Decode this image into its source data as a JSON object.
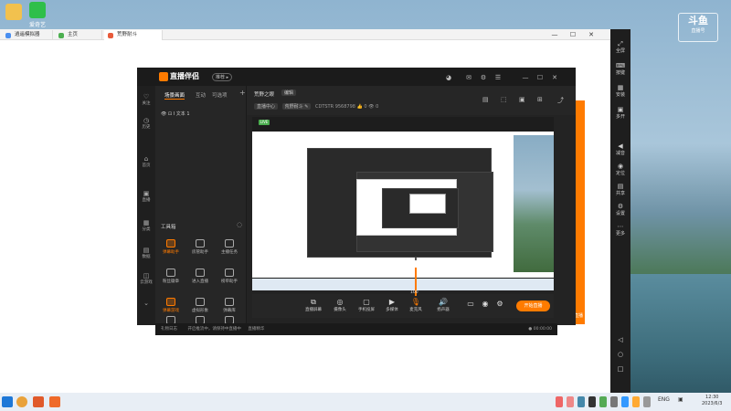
{
  "desktop": {
    "icons": [
      {
        "label": ""
      },
      {
        "label": "爱奇艺"
      }
    ]
  },
  "emulator": {
    "tabs": [
      {
        "label": "逍遥模拟器",
        "active": false
      },
      {
        "label": "主页",
        "active": false
      },
      {
        "label": "荒野耐斗",
        "active": true
      }
    ],
    "controls": {
      "minimize": "—",
      "maximize": "☐",
      "close": "✕"
    },
    "sidebar": [
      {
        "icon": "⤢",
        "label": "全屏"
      },
      {
        "icon": "⌨",
        "label": "按键"
      },
      {
        "icon": "▦",
        "label": "安装"
      },
      {
        "icon": "▣",
        "label": "多开"
      },
      {
        "icon": "◀",
        "label": "减音"
      },
      {
        "icon": "◉",
        "label": "定位"
      },
      {
        "icon": "▤",
        "label": "共享"
      },
      {
        "icon": "⚙",
        "label": "设置"
      },
      {
        "icon": "⋯",
        "label": "更多"
      },
      {
        "icon": "◁",
        "label": ""
      },
      {
        "icon": "○",
        "label": ""
      },
      {
        "icon": "□",
        "label": ""
      }
    ]
  },
  "watermark": {
    "logo": "斗鱼",
    "sub": "直播号"
  },
  "app": {
    "logo": "直播伴侣",
    "badge": "推荐 ▸",
    "top_icons": [
      "◕",
      "✉",
      "⚙",
      "☰",
      "—",
      "☐",
      "✕"
    ],
    "left_nav": [
      {
        "icon": "♡",
        "label": "关注"
      },
      {
        "icon": "◷",
        "label": "历史"
      },
      {
        "icon": "⌂",
        "label": "首页"
      },
      {
        "icon": "▣",
        "label": "直播"
      },
      {
        "icon": "▦",
        "label": "分类"
      },
      {
        "icon": "▤",
        "label": "数据"
      },
      {
        "icon": "◫",
        "label": "云游戏"
      },
      {
        "icon": "⌄",
        "label": ""
      }
    ],
    "scene_tabs": [
      "场景画面",
      "互动",
      "可选项"
    ],
    "scene_add": "+",
    "scene_row": "👁  ⊡  I  文本 1",
    "tools_title": "工具箱",
    "tools": [
      {
        "label": "弹幕助手",
        "orange": true
      },
      {
        "label": "房管助手",
        "orange": false
      },
      {
        "label": "主播任务",
        "orange": false
      },
      {
        "label": "粉丝徽章",
        "orange": false
      },
      {
        "label": "进入直播",
        "orange": false
      },
      {
        "label": "榜单助手",
        "orange": false
      },
      {
        "label": "弹幕游戏",
        "orange": true
      },
      {
        "label": "虚拟形象",
        "orange": false
      },
      {
        "label": "弹幕库",
        "orange": false
      },
      {
        "label": "",
        "orange": false
      },
      {
        "label": "",
        "orange": false
      },
      {
        "label": "",
        "orange": false
      }
    ],
    "room": {
      "title": "荒野之眼",
      "edit": "编辑",
      "chips": [
        "直播中心",
        "荒野耐斗 ✎"
      ],
      "id": "CDTSTR",
      "num": "9568798",
      "likes": "👍 0",
      "viewers": "👁 0"
    },
    "room_icons": [
      "▤",
      "⬚",
      "▣",
      "⊞",
      "⤴"
    ],
    "preview_badge": "LIVE",
    "mic_value": "100",
    "bottom_bar": [
      {
        "icon": "⧉",
        "label": "直播屏幕"
      },
      {
        "icon": "◎",
        "label": "摄像头"
      },
      {
        "icon": "▢",
        "label": "手机投屏"
      },
      {
        "icon": "▶",
        "label": "多媒体"
      },
      {
        "icon": "🎙",
        "label": "麦克风"
      },
      {
        "icon": "🔊",
        "label": "扬声器"
      }
    ],
    "right_icons": [
      "▭",
      "◉",
      "⚙"
    ],
    "start_button": "开始直播",
    "orange_tab": "直播",
    "status": {
      "left": "礼物日志",
      "middle": "开启推流中，请保持中直播中",
      "right": "直播精华",
      "time": "● 00:00:00"
    }
  },
  "taskbar": {
    "tray_lang": "ENG",
    "time": "12:30",
    "date": "2023/6/3"
  }
}
